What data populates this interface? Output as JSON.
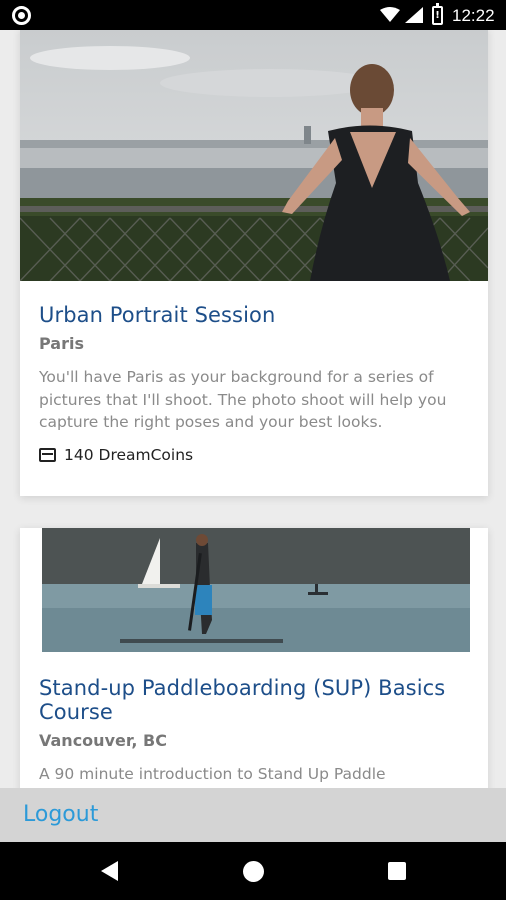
{
  "status_bar": {
    "time": "12:22",
    "battery_glyph": "!"
  },
  "cards": [
    {
      "title": "Urban Portrait Session",
      "location": "Paris",
      "description": "You'll have Paris as your background for a series of pictures that I'll shoot. The photo shoot will help you capture the right poses and your best looks.",
      "price": "140 DreamCoins",
      "image_icon": "photo-paris-portrait"
    },
    {
      "title": "Stand-up Paddleboarding (SUP) Basics Course",
      "location": "Vancouver, BC",
      "description": "A 90 minute introduction to Stand Up Paddle",
      "image_icon": "photo-paddleboarding"
    }
  ],
  "footer": {
    "logout_label": "Logout"
  },
  "colors": {
    "title": "#1d4e89",
    "link": "#2c9ad8",
    "footer_bg": "#d4d4d4"
  },
  "icons": {
    "price": "ticket-icon",
    "nav_back": "back-triangle-icon",
    "nav_home": "home-circle-icon",
    "nav_recent": "recents-square-icon"
  }
}
